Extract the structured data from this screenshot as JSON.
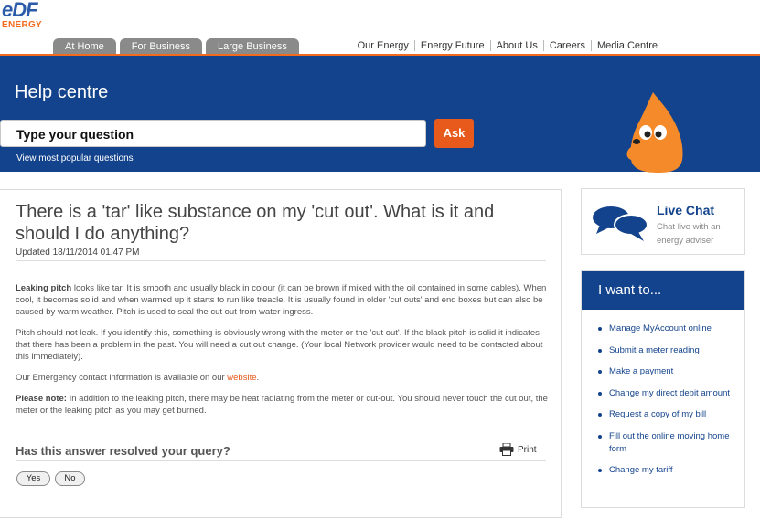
{
  "brand": {
    "logo_main": "eDF",
    "logo_sub": "ENERGY"
  },
  "tabs": [
    {
      "label": "At Home"
    },
    {
      "label": "For Business"
    },
    {
      "label": "Large Business"
    }
  ],
  "nav": [
    {
      "label": "Our Energy"
    },
    {
      "label": "Energy Future"
    },
    {
      "label": "About Us"
    },
    {
      "label": "Careers"
    },
    {
      "label": "Media Centre"
    }
  ],
  "hero": {
    "title": "Help centre",
    "search_value": "Type your question",
    "ask_label": "Ask",
    "popular_link": "View most popular questions"
  },
  "article": {
    "title": "There is a 'tar' like substance on my 'cut out'. What is it and should I do anything?",
    "updated": "Updated 18/11/2014 01.47 PM",
    "p1_bold": "Leaking pitch",
    "p1_text": " looks like tar. It is smooth and usually black in colour (it can be brown if mixed with the oil contained in some cables). When cool, it becomes solid and when warmed up it starts to run like treacle. It is usually found in older 'cut outs' and end boxes but can also be caused by warm weather. Pitch is used to seal the cut out from water ingress.",
    "p2": "Pitch should not leak. If you identify this, something is obviously wrong with the meter or the 'cut out'. If the black pitch is solid it indicates that there has been a problem in the past. You will need a cut out change. (Your local Network provider would need to be contacted about this immediately).",
    "p3_text": "Our Emergency contact information is available on our ",
    "p3_link": "website",
    "p3_end": ".",
    "p4_bold": "Please note:",
    "p4_text": " In addition to the leaking pitch, there may be heat radiating from the meter or cut-out. You should never touch the cut out, the meter or the leaking pitch as you may get burned.",
    "resolved_q": "Has this answer resolved your query?",
    "print_label": "Print",
    "yes_label": "Yes",
    "no_label": "No"
  },
  "livechat": {
    "title": "Live Chat",
    "subtitle": "Chat live with an energy adviser"
  },
  "iwant": {
    "header": "I want to...",
    "items": [
      {
        "label": "Manage MyAccount online"
      },
      {
        "label": "Submit a meter reading"
      },
      {
        "label": "Make a payment"
      },
      {
        "label": "Change my direct debit amount"
      },
      {
        "label": "Request a copy of my bill"
      },
      {
        "label": "Fill out the online moving home form"
      },
      {
        "label": "Change my tariff"
      }
    ]
  },
  "colors": {
    "brand_blue": "#13438c",
    "accent_orange": "#e85a1c",
    "tab_grey": "#8a8a8a"
  }
}
